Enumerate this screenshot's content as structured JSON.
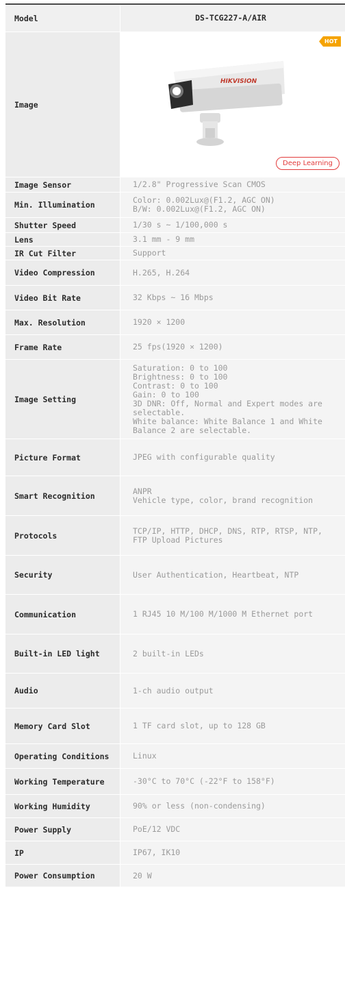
{
  "header": {
    "label": "Model",
    "value": "DS-TCG227-A/AIR"
  },
  "image_row": {
    "label": "Image",
    "hot_badge": "HOT",
    "camera_brand": "HIKVISION",
    "feature_badge": "Deep Learning"
  },
  "specs": [
    {
      "label": "Image Sensor",
      "value": "1/2.8\" Progressive Scan CMOS"
    },
    {
      "label": "Min. Illumination",
      "value": "Color: 0.002Lux@(F1.2, AGC ON)\nB/W: 0.002Lux@(F1.2, AGC ON)"
    },
    {
      "label": "Shutter Speed",
      "value": "1/30 s ~ 1/100,000 s"
    },
    {
      "label": "Lens",
      "value": "3.1 mm - 9 mm"
    },
    {
      "label": "IR Cut Filter",
      "value": "Support"
    },
    {
      "label": "Video Compression",
      "value": "H.265, H.264"
    },
    {
      "label": "Video Bit Rate",
      "value": "32 Kbps ~ 16 Mbps"
    },
    {
      "label": "Max. Resolution",
      "value": "1920 × 1200"
    },
    {
      "label": "Frame Rate",
      "value": "25 fps(1920 × 1200)"
    },
    {
      "label": "Image Setting",
      "value": "Saturation: 0 to 100\nBrightness: 0 to 100\nContrast: 0 to 100\nGain: 0 to 100\n3D DNR: Off, Normal and Expert modes are selectable.\nWhite balance: White Balance 1 and White Balance 2 are selectable."
    },
    {
      "label": "Picture Format",
      "value": "JPEG with configurable quality"
    },
    {
      "label": "Smart Recognition",
      "value": "ANPR\nVehicle type, color, brand recognition"
    },
    {
      "label": "Protocols",
      "value": "TCP/IP, HTTP, DHCP, DNS, RTP, RTSP, NTP, FTP Upload Pictures"
    },
    {
      "label": "Security",
      "value": "User Authentication, Heartbeat, NTP"
    },
    {
      "label": "Communication",
      "value": "1 RJ45 10 M/100 M/1000 M Ethernet port"
    },
    {
      "label": "Built-in LED light",
      "value": "2 built-in LEDs"
    },
    {
      "label": "Audio",
      "value": "1-ch audio output"
    },
    {
      "label": "Memory Card Slot",
      "value": "1 TF card slot, up to 128 GB"
    },
    {
      "label": "Operating Conditions",
      "value": "Linux"
    },
    {
      "label": "Working Temperature",
      "value": "-30°C to 70°C (-22°F to 158°F)"
    },
    {
      "label": "Working Humidity",
      "value": "90% or less (non-condensing)"
    },
    {
      "label": "Power Supply",
      "value": "PoE/12 VDC"
    },
    {
      "label": "IP",
      "value": "IP67, IK10"
    },
    {
      "label": "Power Consumption",
      "value": "20 W"
    }
  ]
}
